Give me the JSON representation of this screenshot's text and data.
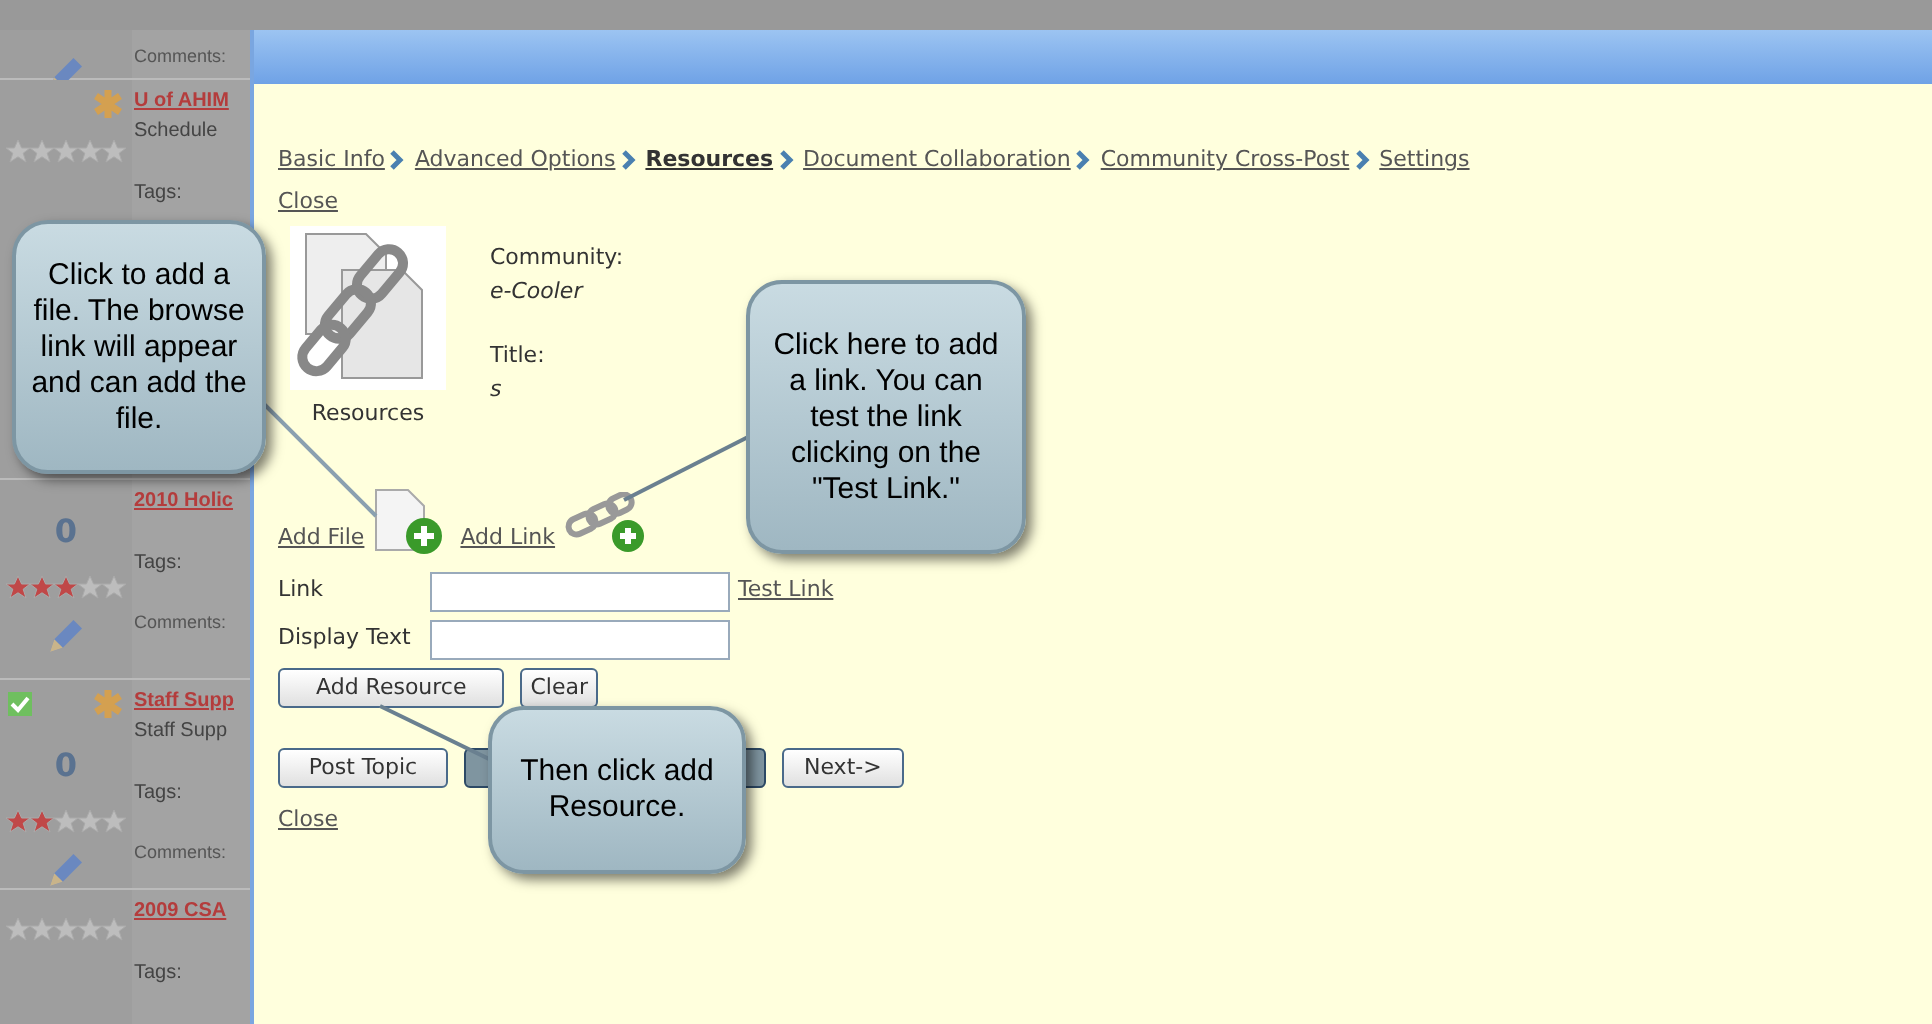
{
  "background_list": {
    "rows": [
      {
        "comments": "Comments:",
        "edit": true
      },
      {
        "title": "U of AHIM",
        "subtitle": "Schedule",
        "tags": "Tags:",
        "stars": 0,
        "starred": true
      },
      {
        "title": "2010 Holic",
        "count": "0",
        "tags": "Tags:",
        "comments": "Comments:",
        "stars": 3,
        "edit": true
      },
      {
        "title": "Staff Supp",
        "subtitle": "Staff Supp",
        "count": "0",
        "tags": "Tags:",
        "comments": "Comments:",
        "stars": 2,
        "starred": true,
        "checked": true,
        "edit": true
      },
      {
        "title": "2009 CSA",
        "tags": "Tags:",
        "stars": 0
      }
    ]
  },
  "dialog": {
    "breadcrumb": [
      {
        "label": "Basic Info",
        "selected": false
      },
      {
        "label": "Advanced Options",
        "selected": false
      },
      {
        "label": "Resources",
        "selected": true
      },
      {
        "label": "Document Collaboration",
        "selected": false
      },
      {
        "label": "Community Cross-Post",
        "selected": false
      },
      {
        "label": "Settings",
        "selected": false
      }
    ],
    "close_top": "Close",
    "resource_caption": "Resources",
    "community_label": "Community:",
    "community": "e-Cooler",
    "title_label": "Title:",
    "title": "s",
    "add_file": "Add File",
    "add_link": "Add Link",
    "fields": [
      {
        "label": "Link"
      },
      {
        "label": "Display Text"
      }
    ],
    "test_link": "Test Link",
    "buttons": [
      "Add Resource",
      "Clear"
    ],
    "nav_buttons": [
      {
        "label": "Post Topic",
        "covered": false
      },
      {
        "covered": true
      },
      {
        "covered": true
      },
      {
        "label": "Next->",
        "covered": false
      }
    ],
    "close_bottom": "Close"
  },
  "callouts": [
    {
      "text": "Click to add a file.  The browse link will appear and can add the file."
    },
    {
      "text": "Click here to add a link. You can test the link clicking on the \"Test Link.\""
    },
    {
      "text": "Then click add Resource."
    }
  ]
}
